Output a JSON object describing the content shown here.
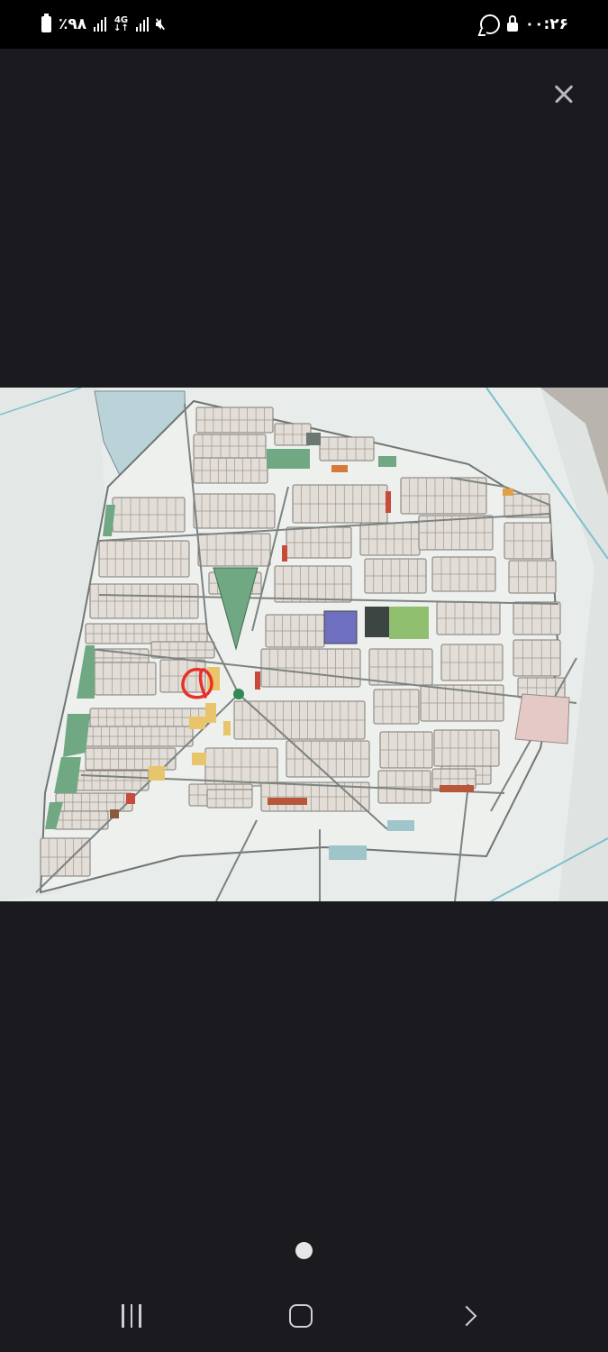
{
  "status_bar": {
    "time": "۰۰:۲۶",
    "battery_text": "٪۹۸",
    "network_label": "4G",
    "icons": [
      "battery-icon",
      "signal-icon",
      "4g-icon",
      "signal-icon",
      "mute-icon",
      "whatsapp-icon",
      "lock-icon"
    ]
  },
  "viewer": {
    "close_icon": "close-icon",
    "image_subject": "site-plan-map",
    "page_indicator_count": 1
  },
  "nav_bar": {
    "buttons": [
      "recents",
      "home",
      "back"
    ]
  },
  "colors": {
    "background": "#1b1b1f",
    "status_bar": "#000000",
    "map_paper": "#e7ecea",
    "green_space": "#6fa882",
    "highlight_circle": "#e8302a"
  }
}
